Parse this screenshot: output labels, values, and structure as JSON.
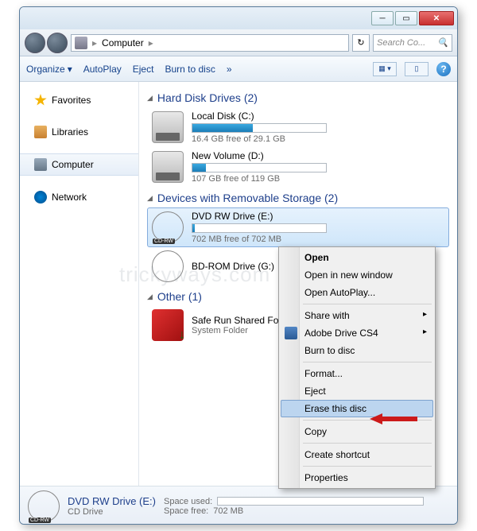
{
  "address": {
    "root": "Computer",
    "sep": "▸"
  },
  "search": {
    "placeholder": "Search Co..."
  },
  "toolbar": {
    "organize": "Organize",
    "autoplay": "AutoPlay",
    "eject": "Eject",
    "burn": "Burn to disc",
    "overflow": "»"
  },
  "nav": {
    "favorites": "Favorites",
    "libraries": "Libraries",
    "computer": "Computer",
    "network": "Network"
  },
  "groups": {
    "hdd": "Hard Disk Drives (2)",
    "removable": "Devices with Removable Storage (2)",
    "other": "Other (1)"
  },
  "drives": {
    "c": {
      "title": "Local Disk (C:)",
      "sub": "16.4 GB free of 29.1 GB"
    },
    "d": {
      "title": "New Volume (D:)",
      "sub": "107 GB free of 119 GB"
    },
    "e": {
      "title": "DVD RW Drive (E:)",
      "sub": "702 MB free of 702 MB",
      "tag": "CD-RW"
    },
    "g": {
      "title": "BD-ROM Drive (G:)"
    },
    "saferun": {
      "title": "Safe Run Shared Folder",
      "sub": "System Folder"
    }
  },
  "details": {
    "title": "DVD RW Drive (E:)",
    "type": "CD Drive",
    "used_label": "Space used:",
    "free_label": "Space free:",
    "free_value": "702 MB"
  },
  "context": {
    "open": "Open",
    "open_new": "Open in new window",
    "open_autoplay": "Open AutoPlay...",
    "share_with": "Share with",
    "adobe": "Adobe Drive CS4",
    "burn": "Burn to disc",
    "format": "Format...",
    "eject": "Eject",
    "erase": "Erase this disc",
    "copy": "Copy",
    "shortcut": "Create shortcut",
    "properties": "Properties"
  },
  "watermark": "trickyways.com"
}
